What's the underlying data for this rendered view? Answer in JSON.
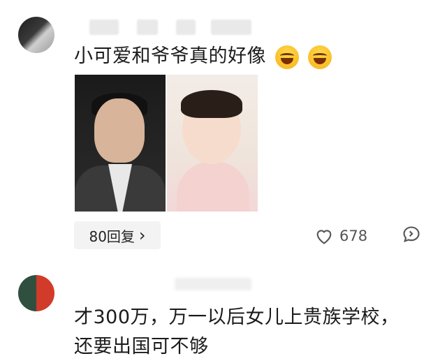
{
  "comments": [
    {
      "text": "小可爱和爷爷真的好像",
      "emojis": [
        "laughing-emoji",
        "laughing-emoji"
      ],
      "replies_label": "80回复",
      "like_count": "678"
    },
    {
      "text_line1": "才300万，万一以后女儿上贵族学校，",
      "text_line2": "还要出国可不够"
    }
  ],
  "icons": {
    "chevron": "›",
    "heart": "heart-icon",
    "message": "message-icon"
  }
}
